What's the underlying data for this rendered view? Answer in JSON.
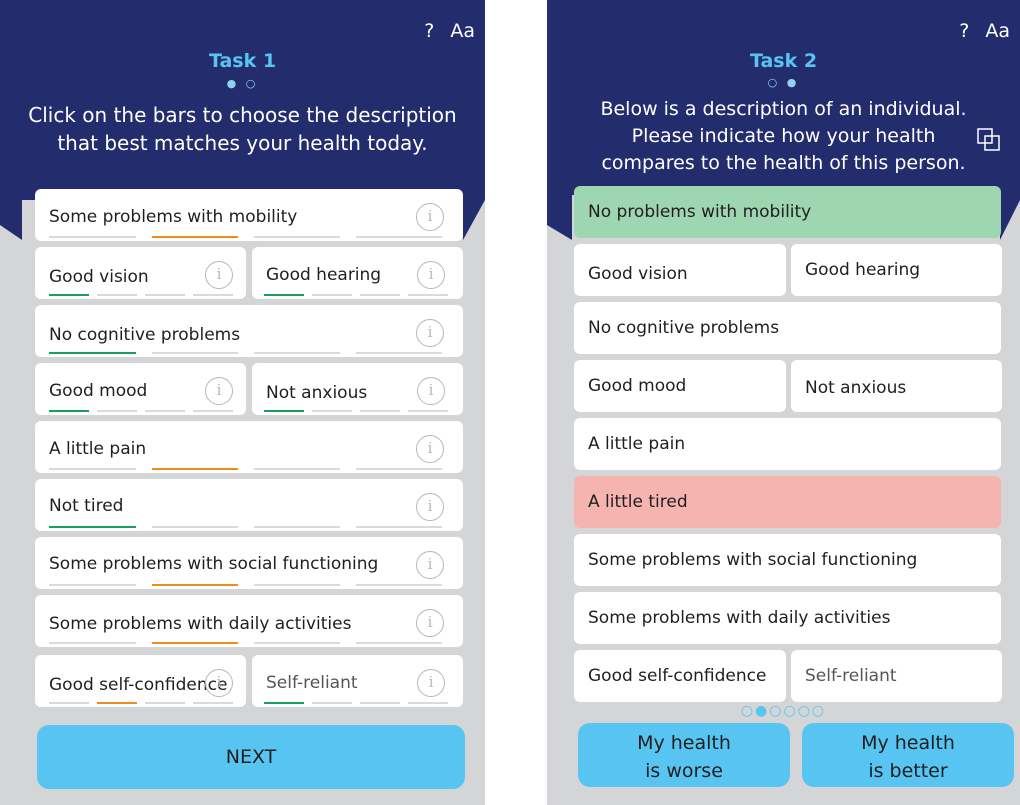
{
  "screen1": {
    "help_icon": "?",
    "text_size_icon": "Aa",
    "task_title": "Task 1",
    "pager_dots": "● ○",
    "instruction_line1": "Click on the bars to choose the description",
    "instruction_line2": "that best matches your health today.",
    "info_glyph": "i",
    "items": [
      {
        "label": "Some problems with mobility",
        "selected_level": 2,
        "level_color": "orange"
      },
      {
        "label": "Good vision",
        "selected_level": 1,
        "level_color": "green"
      },
      {
        "label": "Good hearing",
        "selected_level": 1,
        "level_color": "green"
      },
      {
        "label": "No cognitive problems",
        "selected_level": 1,
        "level_color": "green"
      },
      {
        "label": "Good mood",
        "selected_level": 1,
        "level_color": "green"
      },
      {
        "label": "Not anxious",
        "selected_level": 1,
        "level_color": "green"
      },
      {
        "label": "A little pain",
        "selected_level": 2,
        "level_color": "orange"
      },
      {
        "label": "Not tired",
        "selected_level": 1,
        "level_color": "green"
      },
      {
        "label": "Some problems with social functioning",
        "selected_level": 2,
        "level_color": "orange"
      },
      {
        "label": "Some problems with daily activities",
        "selected_level": 2,
        "level_color": "orange"
      },
      {
        "label": "Good self-confidence",
        "selected_level": 2,
        "level_color": "orange"
      },
      {
        "label": "Self-reliant",
        "selected_level": 1,
        "level_color": "green"
      }
    ],
    "next_button": "NEXT"
  },
  "screen2": {
    "help_icon": "?",
    "text_size_icon": "Aa",
    "task_title": "Task 2",
    "pager_dots": "○ ●",
    "instruction_line1": "Below is a description of an individual.",
    "instruction_line2": "Please indicate how your health",
    "instruction_line3": "compares to the health of this person.",
    "compare_icon": "overlap-squares-icon",
    "items": [
      {
        "label": "No problems with mobility",
        "highlight": "#9fd6b2"
      },
      {
        "label": "Good vision"
      },
      {
        "label": "Good hearing"
      },
      {
        "label": "No cognitive problems"
      },
      {
        "label": "Good mood"
      },
      {
        "label": "Not anxious"
      },
      {
        "label": "A little pain"
      },
      {
        "label": "A little tired",
        "highlight": "#f5b4b0"
      },
      {
        "label": "Some problems with social functioning"
      },
      {
        "label": "Some problems with daily activities"
      },
      {
        "label": "Good self-confidence"
      },
      {
        "label": "Self-reliant"
      }
    ],
    "progress_dots": "○●○○○○",
    "worse_button_line1": "My health",
    "worse_button_line2": "is worse",
    "better_button_line1": "My health",
    "better_button_line2": "is better"
  },
  "colors": {
    "header": "#232d6e",
    "accent": "#57c4f2",
    "green_bar": "#17a05a",
    "orange_bar": "#f08c1e",
    "background": "#d4d5d7"
  }
}
